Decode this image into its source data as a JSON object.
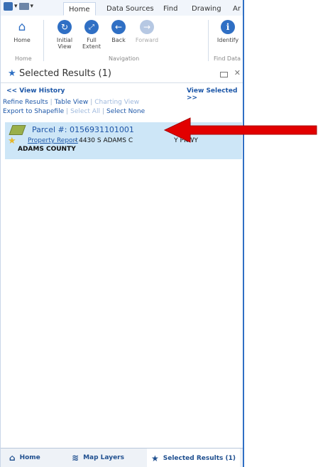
{
  "tabs": [
    "Home",
    "Data Sources",
    "Find",
    "Drawing",
    "Ar"
  ],
  "ribbon": {
    "home_label": "Home",
    "initial_view_label": "Initial\nView",
    "full_extent_label": "Full\nExtent",
    "back_label": "Back",
    "forward_label": "Forward",
    "identify_label": "Identify",
    "group_home": "Home",
    "group_navigation": "Navigation",
    "group_find_data": "Find Data"
  },
  "panel": {
    "title": "Selected Results (1)",
    "view_history": "<< View History",
    "view_selected": "View Selected >>",
    "refine_results": "Refine Results",
    "table_view": "Table View",
    "charting_view": "Charting View",
    "export_shapefile": "Export to Shapefile",
    "select_all": "Select All",
    "select_none": "Select None"
  },
  "result": {
    "parcel_title": "Parcel #: 0156931101001",
    "property_report": "Property Report",
    "address": "- 4430 S ADAMS C",
    "address_tail": "Y PKWY",
    "county": "ADAMS COUNTY"
  },
  "bottom_tabs": {
    "home": "Home",
    "map_layers": "Map Layers",
    "selected_results": "Selected Results (1)"
  },
  "colors": {
    "accent": "#2f6fc4",
    "link": "#1d57a8",
    "result_highlight": "#cde6f7",
    "arrow": "#e20000"
  }
}
